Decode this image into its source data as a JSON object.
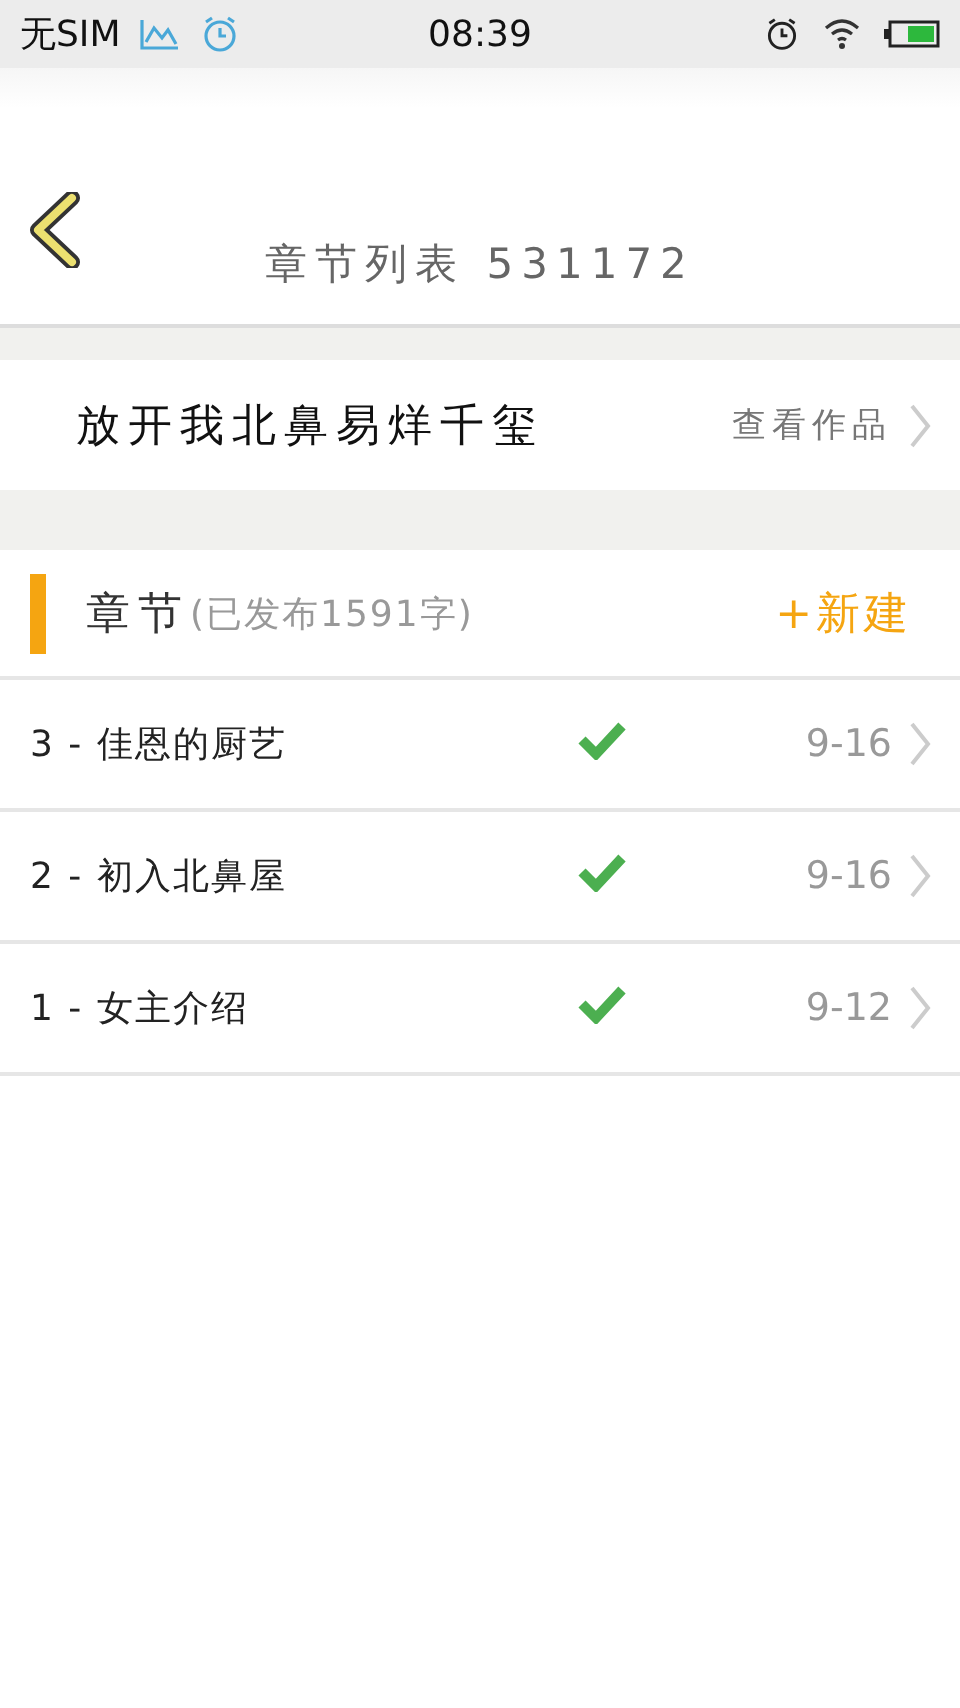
{
  "status_bar": {
    "carrier": "无SIM",
    "time": "08:39"
  },
  "header": {
    "title": "章节列表",
    "id": "531172"
  },
  "book": {
    "title": "放开我北鼻易烊千玺",
    "link": "查看作品"
  },
  "section": {
    "title": "章节",
    "info": "(已发布1591字)",
    "action": "+新建"
  },
  "chapters": [
    {
      "title": "3 - 佳恩的厨艺",
      "published": true,
      "date": "9-16"
    },
    {
      "title": "2 - 初入北鼻屋",
      "published": true,
      "date": "9-16"
    },
    {
      "title": "1 - 女主介绍",
      "published": true,
      "date": "9-12"
    }
  ]
}
